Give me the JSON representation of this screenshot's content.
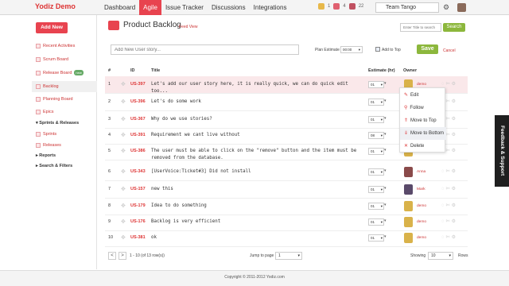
{
  "app": {
    "brand": "Yodiz Demo"
  },
  "nav": {
    "tabs": [
      {
        "label": "Dashboard",
        "active": false
      },
      {
        "label": "Agile",
        "active": true
      },
      {
        "label": "Issue Tracker",
        "active": false
      },
      {
        "label": "Discussions",
        "active": false
      },
      {
        "label": "Integrations",
        "active": false
      }
    ],
    "icon_counts": [
      "1",
      "4",
      "22"
    ],
    "team": "Team Tango"
  },
  "sidebar": {
    "add_new": "Add New",
    "items": [
      {
        "label": "Recent Activities"
      },
      {
        "label": "Scrum Board"
      },
      {
        "label": "Release Board",
        "tag": "new"
      },
      {
        "label": "Backlog",
        "active": true
      },
      {
        "label": "Planning Board"
      },
      {
        "label": "Epics"
      }
    ],
    "section_sprints": "Sprints & Releases",
    "sub_sprints": "Sprints",
    "sub_releases": "Releases",
    "section_reports": "Reports",
    "section_search": "Search & Filters"
  },
  "page": {
    "title": "Product Backlog",
    "feed_view": "Feed View",
    "search_placeholder": "Enter Title to search",
    "search_button": "Search"
  },
  "composer": {
    "placeholder": "Add New User story...",
    "plan_label": "Plan Estimate",
    "plan_value": "00:00",
    "add_to_top": "Add to Top",
    "save": "Save",
    "cancel": "Cancel"
  },
  "table": {
    "headers": {
      "num": "#",
      "id": "ID",
      "title": "Title",
      "estimate": "Estimate (hr)",
      "owner": "Owner"
    },
    "rows": [
      {
        "num": "1",
        "id": "US-397",
        "title": "Let's add our user story here, it is really quick, we can do quick edit too...",
        "est": "01",
        "owner": "demo",
        "avatar": "#d9b24a"
      },
      {
        "num": "2",
        "id": "US-396",
        "title": "Let's do some work",
        "est": "01",
        "owner": "",
        "avatar": ""
      },
      {
        "num": "3",
        "id": "US-367",
        "title": "Why do we use stories?",
        "est": "01",
        "owner": "",
        "avatar": ""
      },
      {
        "num": "4",
        "id": "US-391",
        "title": "Requirement we cant live without",
        "est": "08",
        "owner": "",
        "avatar": ""
      },
      {
        "num": "5",
        "id": "US-386",
        "title": "The user must be able to click on the \"remove\" button and the item must be removed from the database.",
        "est": "01",
        "owner": "demo",
        "avatar": "#d9b24a"
      },
      {
        "num": "6",
        "id": "US-343",
        "title": "[UserVoice:Ticket#3] Did not install",
        "est": "01",
        "owner": "Anna",
        "avatar": "#8a4a4a"
      },
      {
        "num": "7",
        "id": "US-157",
        "title": "new this",
        "est": "01",
        "owner": "Mark",
        "avatar": "#5a4a6a"
      },
      {
        "num": "8",
        "id": "US-179",
        "title": "Idea to do something",
        "est": "01",
        "owner": "demo",
        "avatar": "#d9b24a"
      },
      {
        "num": "9",
        "id": "US-176",
        "title": "Backlog is very efficient",
        "est": "01",
        "owner": "demo",
        "avatar": "#d9b24a"
      },
      {
        "num": "10",
        "id": "US-381",
        "title": "ok",
        "est": "01",
        "owner": "demo",
        "avatar": "#d9b24a"
      }
    ]
  },
  "context_menu": {
    "items": [
      {
        "icon": "✎",
        "label": "Edit"
      },
      {
        "icon": "⚲",
        "label": "Follow"
      },
      {
        "icon": "⇑",
        "label": "Move to Top"
      },
      {
        "icon": "⇓",
        "label": "Move to Bottom",
        "hover": true
      },
      {
        "icon": "✕",
        "label": "Delete"
      }
    ]
  },
  "pagination": {
    "range": "1 - 10 (of 13 row(s))",
    "jump_label": "Jump to page",
    "jump_value": "1",
    "showing_label": "Showing",
    "showing_value": "10",
    "rows_label": "Rows"
  },
  "footer": {
    "text": "Copyright © 2011-2012 Yodiz.com"
  },
  "feedback_tab": "Feedback & Support",
  "colors": {
    "accent": "#e8434f",
    "green": "#8cb73c",
    "link": "#cc3333"
  }
}
